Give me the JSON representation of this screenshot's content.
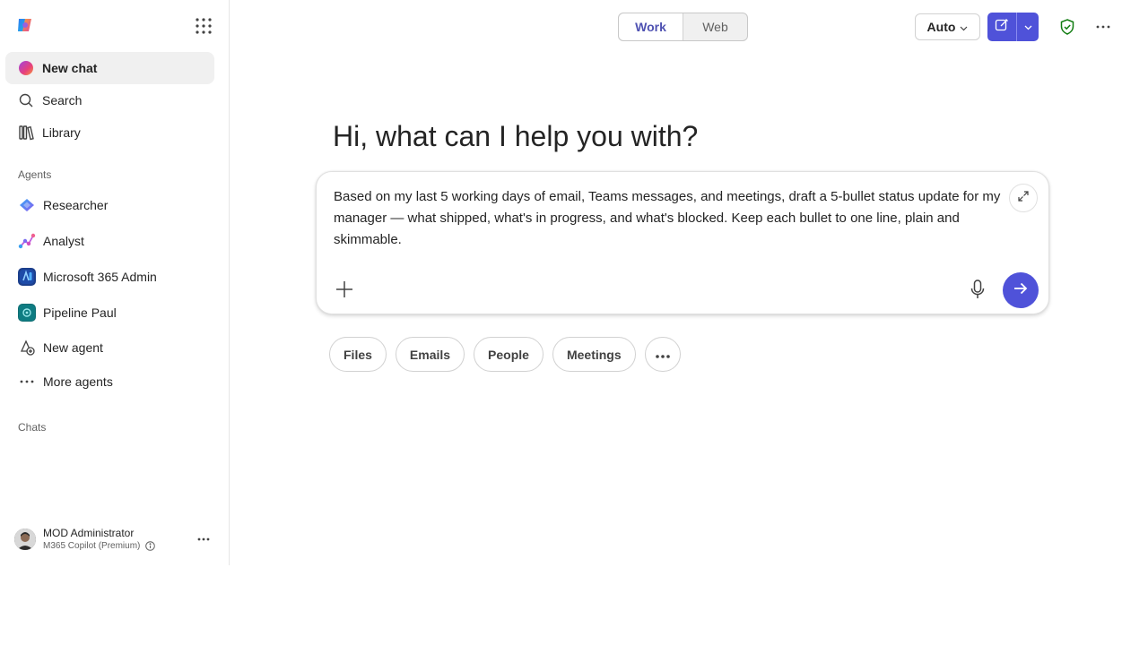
{
  "sidebar": {
    "nav": [
      {
        "label": "New chat",
        "icon": "copilot-chat-icon"
      },
      {
        "label": "Search",
        "icon": "search-icon"
      },
      {
        "label": "Library",
        "icon": "library-icon"
      }
    ],
    "agents_heading": "Agents",
    "agents": [
      {
        "label": "Researcher",
        "icon": "researcher-icon"
      },
      {
        "label": "Analyst",
        "icon": "analyst-icon"
      },
      {
        "label": "Microsoft 365 Admin",
        "icon": "m365-admin-icon"
      },
      {
        "label": "Pipeline Paul",
        "icon": "pipeline-paul-icon"
      },
      {
        "label": "New agent",
        "icon": "new-agent-icon"
      },
      {
        "label": "More agents",
        "icon": "more-agents-icon"
      }
    ],
    "chats_heading": "Chats",
    "user": {
      "name": "MOD Administrator",
      "plan": "M365 Copilot (Premium)"
    }
  },
  "topbar": {
    "tabs": [
      {
        "label": "Work",
        "active": true
      },
      {
        "label": "Web",
        "active": false
      }
    ],
    "model_selector": "Auto"
  },
  "main": {
    "greeting": "Hi, what can I help you with?",
    "prompt": "Based on my last 5 working days of email, Teams messages, and meetings, draft a 5-bullet status update for my manager — what shipped, what's in progress, and what's blocked. Keep each bullet to one line, plain and skimmable.",
    "chips": [
      "Files",
      "Emails",
      "People",
      "Meetings"
    ]
  },
  "colors": {
    "accent": "#4f52d9",
    "active_tab_text": "#4f52b2",
    "shield": "#107c10"
  }
}
